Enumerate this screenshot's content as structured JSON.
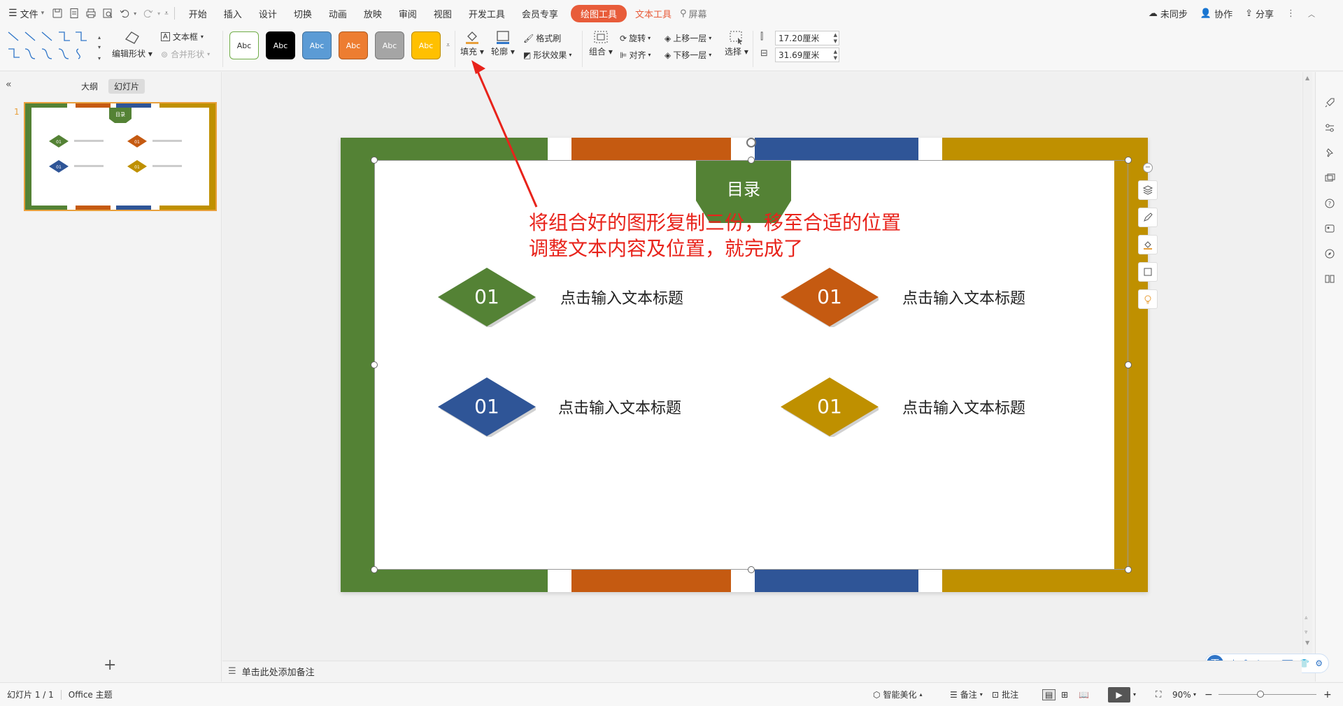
{
  "menubar": {
    "file_label": "文件",
    "tabs": [
      "开始",
      "插入",
      "设计",
      "切换",
      "动画",
      "放映",
      "审阅",
      "视图",
      "开发工具",
      "会员专享"
    ],
    "draw_tools": "绘图工具",
    "text_tools": "文本工具",
    "search_label": "屏幕",
    "sync": "未同步",
    "collab": "协作",
    "share": "分享"
  },
  "ribbon": {
    "edit_shape": "编辑形状",
    "textbox": "文本框",
    "merge_shape": "合并形状",
    "styles": [
      {
        "label": "Abc",
        "bg": "#ffffff",
        "fg": "#333333",
        "border": "#70ad47"
      },
      {
        "label": "Abc",
        "bg": "#000000",
        "fg": "#ffffff",
        "border": "#000000"
      },
      {
        "label": "Abc",
        "bg": "#5b9bd5",
        "fg": "#ffffff",
        "border": "#41719c"
      },
      {
        "label": "Abc",
        "bg": "#ed7d31",
        "fg": "#ffffff",
        "border": "#ae5a21"
      },
      {
        "label": "Abc",
        "bg": "#a5a5a5",
        "fg": "#ffffff",
        "border": "#787878"
      },
      {
        "label": "Abc",
        "bg": "#ffc000",
        "fg": "#ffffff",
        "border": "#bc8c00"
      }
    ],
    "fill": "填充",
    "outline": "轮廓",
    "format_painter": "格式刷",
    "shape_effect": "形状效果",
    "group": "组合",
    "rotate": "旋转",
    "align": "对齐",
    "bring_forward": "上移一层",
    "send_backward": "下移一层",
    "select": "选择",
    "height": "17.20厘米",
    "width": "31.69厘米"
  },
  "panel": {
    "tab_outline": "大纲",
    "tab_slides": "幻灯片",
    "slide_number": "1",
    "add_slide": "+"
  },
  "slide": {
    "title": "目录",
    "items": [
      {
        "num": "01",
        "label": "点击输入文本标题",
        "color": "#548235"
      },
      {
        "num": "01",
        "label": "点击输入文本标题",
        "color": "#c55a11"
      },
      {
        "num": "01",
        "label": "点击输入文本标题",
        "color": "#2f5597"
      },
      {
        "num": "01",
        "label": "点击输入文本标题",
        "color": "#bf9000"
      }
    ],
    "colors": {
      "green": "#548235",
      "orange": "#c55a11",
      "blue": "#2f5597",
      "gold": "#bf9000"
    }
  },
  "annotation": {
    "line1": "将组合好的图形复制三份，移至合适的位置",
    "line2": "调整文本内容及位置，就完成了"
  },
  "notes_placeholder": "单击此处添加备注",
  "status": {
    "slide_count": "幻灯片 1 / 1",
    "theme": "Office 主题",
    "beautify": "智能美化",
    "notes": "备注",
    "comments": "批注",
    "zoom": "90%"
  },
  "ime": {
    "logo": "王",
    "mode": "中"
  }
}
